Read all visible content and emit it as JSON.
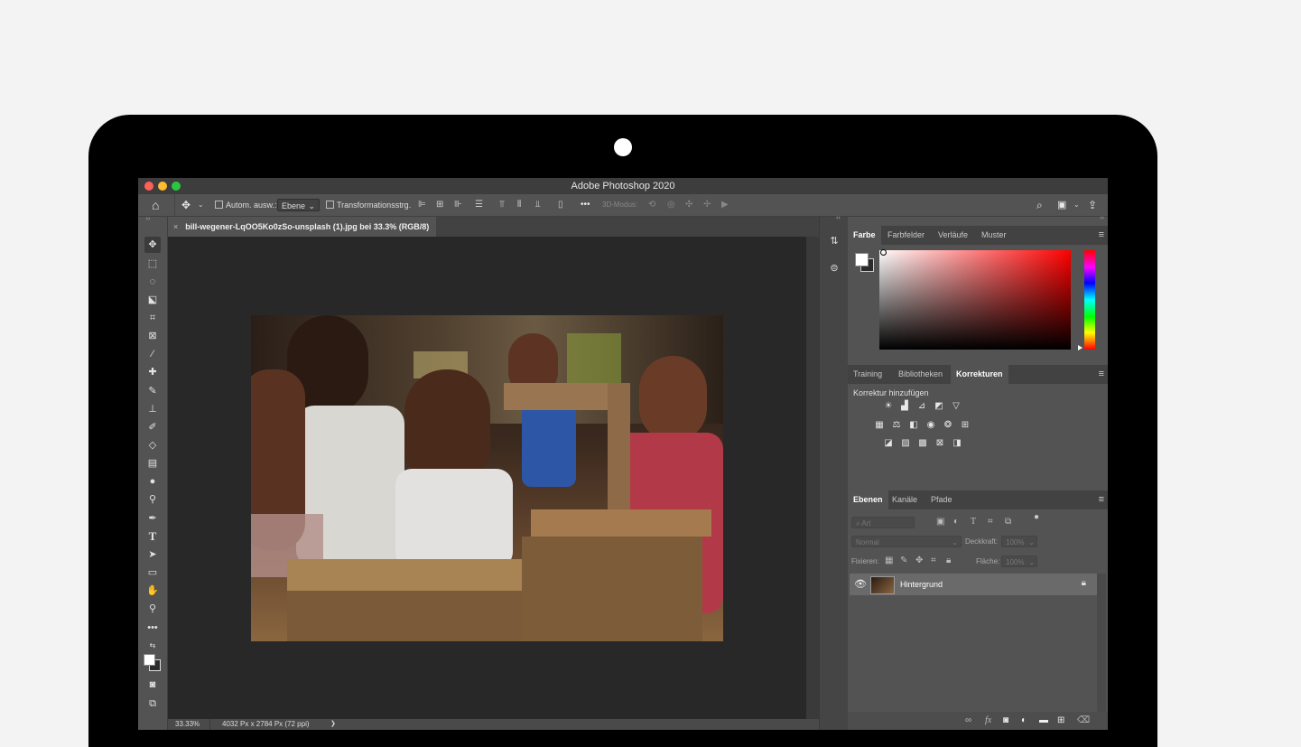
{
  "app": {
    "window_title": "Adobe Photoshop 2020"
  },
  "options_bar": {
    "auto_select_label": "Autom. ausw.:",
    "auto_select_value": "Ebene",
    "transform_label": "Transformationsstrg.",
    "more_label": "•••",
    "mode_3d_label": "3D-Modus:"
  },
  "document": {
    "tab_title": "bill-wegener-LqOO5Ko0zSo-unsplash (1).jpg bei 33.3% (RGB/8)",
    "zoom": "33.33%",
    "dimensions": "4032 Px x 2784 Px (72 ppi)",
    "status_arrow": "❯"
  },
  "color_panel": {
    "tabs": [
      "Farbe",
      "Farbfelder",
      "Verläufe",
      "Muster"
    ],
    "active_tab": "Farbe",
    "base_hue": "#ff0000"
  },
  "adjustments_panel": {
    "tabs": [
      "Training",
      "Bibliotheken",
      "Korrekturen"
    ],
    "active_tab": "Korrekturen",
    "heading": "Korrektur hinzufügen"
  },
  "layers_panel": {
    "tabs": [
      "Ebenen",
      "Kanäle",
      "Pfade"
    ],
    "active_tab": "Ebenen",
    "filter_placeholder": "Art",
    "blend_mode": "Normal",
    "opacity_label": "Deckkraft:",
    "opacity_value": "100%",
    "lock_label": "Fixieren:",
    "fill_label": "Fläche:",
    "fill_value": "100%",
    "layers": [
      {
        "name": "Hintergrund",
        "visible": true,
        "locked": true
      }
    ]
  },
  "icons": {
    "menu": "≡",
    "collapse": "‹‹",
    "expand": "››"
  }
}
